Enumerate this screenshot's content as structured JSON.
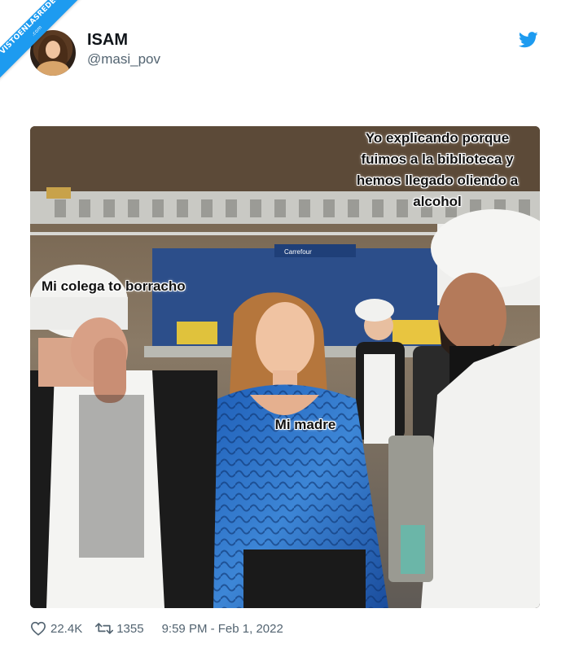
{
  "watermark": {
    "text": "VISTOENLASREDES",
    "subtext": ".com"
  },
  "author": {
    "display_name": "ISAM",
    "handle": "@masi_pov"
  },
  "meme": {
    "caption_top": "Yo explicando porque fuimos a la biblioteca y hemos llegado oliendo a alcohol",
    "caption_left": "Mi colega to borracho",
    "caption_center": "Mi madre",
    "sign_text": "Carrefour"
  },
  "footer": {
    "likes": "22.4K",
    "retweets": "1355",
    "timestamp": "9:59 PM - Feb 1, 2022"
  },
  "colors": {
    "twitter_blue": "#1d9bf0",
    "secondary_text": "#536471"
  },
  "icons": {
    "platform": "twitter-bird-icon",
    "like": "heart-icon",
    "retweet": "retweet-icon"
  }
}
